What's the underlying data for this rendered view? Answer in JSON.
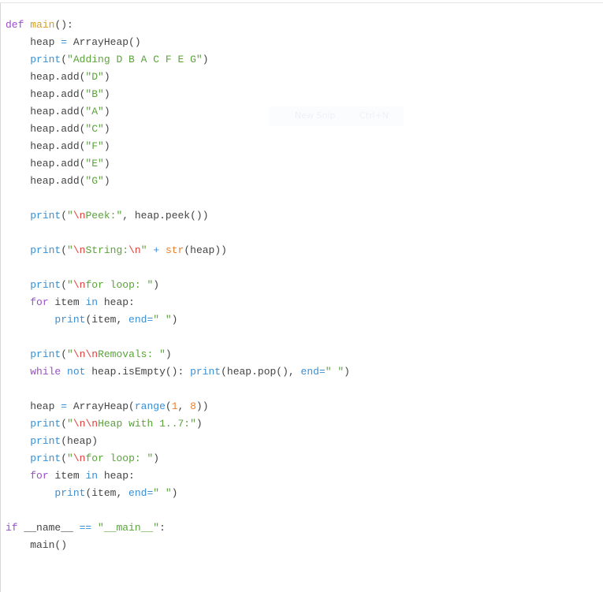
{
  "overlay": {
    "new_snip_label": "New Snip",
    "new_snip_shortcut": "Ctrl+N"
  },
  "colors": {
    "keyword": "#9a4fc7",
    "builtin": "#3a8fd4",
    "string": "#5aa33b",
    "escape": "#e0403a",
    "number": "#f07f2a",
    "function_name": "#d4a017",
    "text": "#444444"
  },
  "code_lines": [
    [
      [
        "def",
        "kw"
      ],
      [
        " ",
        "tx"
      ],
      [
        "main",
        "fn"
      ],
      [
        "():",
        "tx"
      ]
    ],
    [
      [
        "    heap ",
        "tx"
      ],
      [
        "=",
        "op"
      ],
      [
        " ArrayHeap()",
        "tx"
      ]
    ],
    [
      [
        "    ",
        "tx"
      ],
      [
        "print",
        "bi"
      ],
      [
        "(",
        "tx"
      ],
      [
        "\"Adding D B A C F E G\"",
        "st"
      ],
      [
        ")",
        "tx"
      ]
    ],
    [
      [
        "    heap.add(",
        "tx"
      ],
      [
        "\"D\"",
        "st"
      ],
      [
        ")",
        "tx"
      ]
    ],
    [
      [
        "    heap.add(",
        "tx"
      ],
      [
        "\"B\"",
        "st"
      ],
      [
        ")",
        "tx"
      ]
    ],
    [
      [
        "    heap.add(",
        "tx"
      ],
      [
        "\"A\"",
        "st"
      ],
      [
        ")",
        "tx"
      ]
    ],
    [
      [
        "    heap.add(",
        "tx"
      ],
      [
        "\"C\"",
        "st"
      ],
      [
        ")",
        "tx"
      ]
    ],
    [
      [
        "    heap.add(",
        "tx"
      ],
      [
        "\"F\"",
        "st"
      ],
      [
        ")",
        "tx"
      ]
    ],
    [
      [
        "    heap.add(",
        "tx"
      ],
      [
        "\"E\"",
        "st"
      ],
      [
        ")",
        "tx"
      ]
    ],
    [
      [
        "    heap.add(",
        "tx"
      ],
      [
        "\"G\"",
        "st"
      ],
      [
        ")",
        "tx"
      ]
    ],
    [],
    [
      [
        "    ",
        "tx"
      ],
      [
        "print",
        "bi"
      ],
      [
        "(",
        "tx"
      ],
      [
        "\"",
        "st"
      ],
      [
        "\\n",
        "es"
      ],
      [
        "Peek:\"",
        "st"
      ],
      [
        ", heap.peek())",
        "tx"
      ]
    ],
    [],
    [
      [
        "    ",
        "tx"
      ],
      [
        "print",
        "bi"
      ],
      [
        "(",
        "tx"
      ],
      [
        "\"",
        "st"
      ],
      [
        "\\n",
        "es"
      ],
      [
        "String:",
        "st"
      ],
      [
        "\\n",
        "es"
      ],
      [
        "\"",
        "st"
      ],
      [
        " ",
        "tx"
      ],
      [
        "+",
        "op"
      ],
      [
        " ",
        "tx"
      ],
      [
        "str",
        "nu"
      ],
      [
        "(heap))",
        "tx"
      ]
    ],
    [],
    [
      [
        "    ",
        "tx"
      ],
      [
        "print",
        "bi"
      ],
      [
        "(",
        "tx"
      ],
      [
        "\"",
        "st"
      ],
      [
        "\\n",
        "es"
      ],
      [
        "for loop: \"",
        "st"
      ],
      [
        ")",
        "tx"
      ]
    ],
    [
      [
        "    ",
        "tx"
      ],
      [
        "for",
        "kw"
      ],
      [
        " item ",
        "tx"
      ],
      [
        "in",
        "bi"
      ],
      [
        " heap:",
        "tx"
      ]
    ],
    [
      [
        "        ",
        "tx"
      ],
      [
        "print",
        "bi"
      ],
      [
        "(item, ",
        "tx"
      ],
      [
        "end=",
        "bi"
      ],
      [
        "\" \"",
        "st"
      ],
      [
        ")",
        "tx"
      ]
    ],
    [],
    [
      [
        "    ",
        "tx"
      ],
      [
        "print",
        "bi"
      ],
      [
        "(",
        "tx"
      ],
      [
        "\"",
        "st"
      ],
      [
        "\\n\\n",
        "es"
      ],
      [
        "Removals: \"",
        "st"
      ],
      [
        ")",
        "tx"
      ]
    ],
    [
      [
        "    ",
        "tx"
      ],
      [
        "while",
        "kw"
      ],
      [
        " ",
        "tx"
      ],
      [
        "not",
        "bi"
      ],
      [
        " heap.isEmpty(): ",
        "tx"
      ],
      [
        "print",
        "bi"
      ],
      [
        "(heap.pop(), ",
        "tx"
      ],
      [
        "end=",
        "bi"
      ],
      [
        "\" \"",
        "st"
      ],
      [
        ")",
        "tx"
      ]
    ],
    [],
    [
      [
        "    heap ",
        "tx"
      ],
      [
        "=",
        "op"
      ],
      [
        " ArrayHeap(",
        "tx"
      ],
      [
        "range",
        "bi"
      ],
      [
        "(",
        "tx"
      ],
      [
        "1",
        "nu"
      ],
      [
        ", ",
        "tx"
      ],
      [
        "8",
        "nu"
      ],
      [
        "))",
        "tx"
      ]
    ],
    [
      [
        "    ",
        "tx"
      ],
      [
        "print",
        "bi"
      ],
      [
        "(",
        "tx"
      ],
      [
        "\"",
        "st"
      ],
      [
        "\\n\\n",
        "es"
      ],
      [
        "Heap with 1..7:\"",
        "st"
      ],
      [
        ")",
        "tx"
      ]
    ],
    [
      [
        "    ",
        "tx"
      ],
      [
        "print",
        "bi"
      ],
      [
        "(heap)",
        "tx"
      ]
    ],
    [
      [
        "    ",
        "tx"
      ],
      [
        "print",
        "bi"
      ],
      [
        "(",
        "tx"
      ],
      [
        "\"",
        "st"
      ],
      [
        "\\n",
        "es"
      ],
      [
        "for loop: \"",
        "st"
      ],
      [
        ")",
        "tx"
      ]
    ],
    [
      [
        "    ",
        "tx"
      ],
      [
        "for",
        "kw"
      ],
      [
        " item ",
        "tx"
      ],
      [
        "in",
        "bi"
      ],
      [
        " heap:",
        "tx"
      ]
    ],
    [
      [
        "        ",
        "tx"
      ],
      [
        "print",
        "bi"
      ],
      [
        "(item, ",
        "tx"
      ],
      [
        "end=",
        "bi"
      ],
      [
        "\" \"",
        "st"
      ],
      [
        ")",
        "tx"
      ]
    ],
    [],
    [
      [
        "if",
        "kw"
      ],
      [
        " __name__ ",
        "tx"
      ],
      [
        "==",
        "op"
      ],
      [
        " ",
        "tx"
      ],
      [
        "\"__main__\"",
        "st"
      ],
      [
        ":",
        "tx"
      ]
    ],
    [
      [
        "    main()",
        "tx"
      ]
    ]
  ]
}
